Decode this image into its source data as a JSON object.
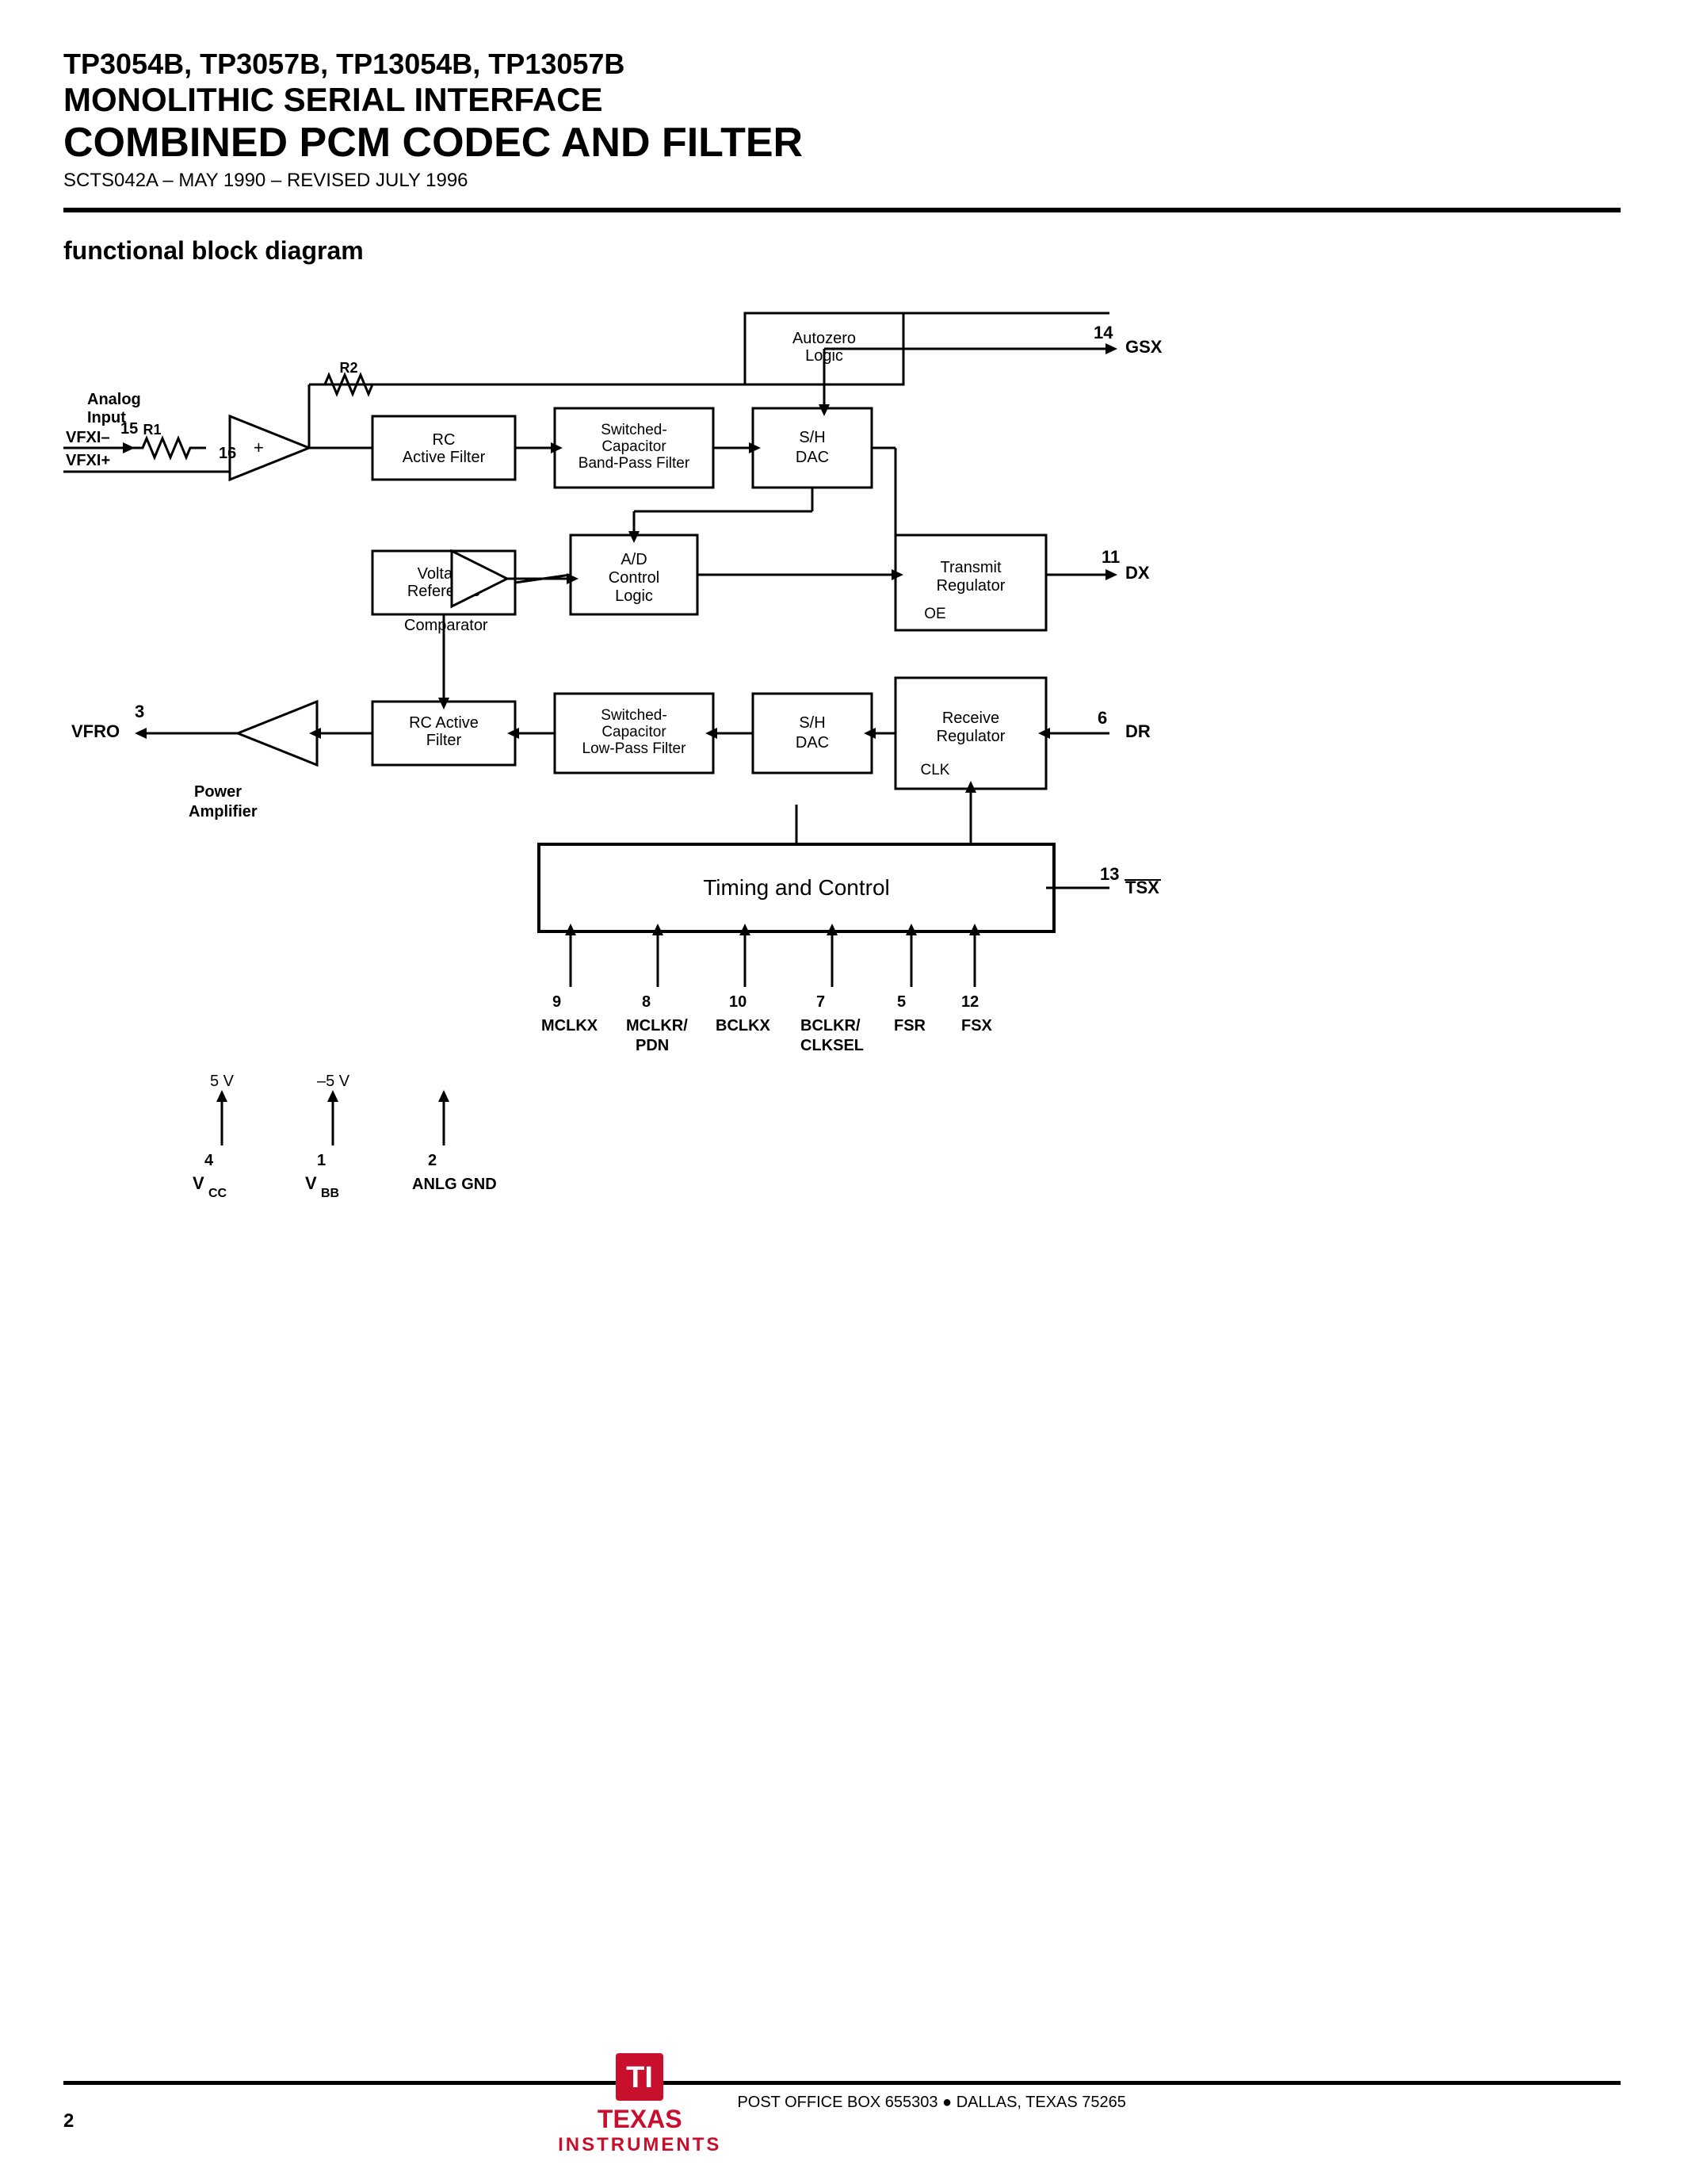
{
  "header": {
    "line1": "TP3054B, TP3057B, TP13054B, TP13057B",
    "line2": "MONOLITHIC SERIAL INTERFACE",
    "line3": "COMBINED PCM CODEC AND FILTER",
    "subtitle": "SCTS042A – MAY 1990 – REVISED JULY 1996"
  },
  "section": {
    "title": "functional block diagram"
  },
  "blocks": {
    "autozero_logic": "Autozero\nLogic",
    "rc_active_filter_top": "RC\nActive Filter",
    "switched_cap_bpf": "Switched-\nCapacitor\nBand-Pass Filter",
    "sh_dac_top": "S/H\nDAC",
    "voltage_reference": "Voltage\nReference",
    "ad_control_logic": "A/D\nControl\nLogic",
    "transmit_regulator": "Transmit\nRegulator",
    "rc_active_filter_bot": "RC Active\nFilter",
    "switched_cap_lpf": "Switched-\nCapacitor\nLow-Pass Filter",
    "sh_dac_bot": "S/H\nDAC",
    "receive_regulator": "Receive\nRegulator",
    "timing_and_control": "Timing and Control"
  },
  "pins": {
    "gsx": {
      "num": "14",
      "label": "GSX"
    },
    "dx": {
      "num": "11",
      "label": "DX"
    },
    "dr": {
      "num": "6",
      "label": "DR"
    },
    "tsx": {
      "num": "13",
      "label": "͟TSX"
    },
    "vfxi_minus": {
      "num": "15",
      "label": "VFXI−"
    },
    "vfxi_plus": {
      "num": "16",
      "label": "VFXI+"
    },
    "vfro": {
      "num": "3",
      "label": "VFRO"
    },
    "vcc": {
      "num": "4",
      "label": "Vᴄᴄ"
    },
    "vbb": {
      "num": "1",
      "label": "Vʙʙ"
    },
    "anlg_gnd": {
      "num": "2",
      "label": "ANLG GND"
    },
    "mclkx": {
      "num": "9",
      "label": "MCLKX"
    },
    "mclkr_pdn": {
      "num": "8",
      "label": "MCLKR/\nPDN"
    },
    "bclkx": {
      "num": "10",
      "label": "BCLKX"
    },
    "bclkr_clksel": {
      "num": "7",
      "label": "BCLKR/\nCLKSEL"
    },
    "fsr": {
      "num": "5",
      "label": "FSR"
    },
    "fsx": {
      "num": "12",
      "label": "FSX"
    }
  },
  "labels": {
    "analog_input": "Analog\nInput",
    "r1": "R1",
    "r2": "R2",
    "comparator": "Comparator",
    "oe": "OE",
    "clk": "CLK",
    "power_amplifier": "Power\nAmplifier",
    "vcc_val": "5 V",
    "vbb_val": "−5 V"
  },
  "footer": {
    "page": "2",
    "address": "POST OFFICE BOX 655303 ● DALLAS, TEXAS 75265",
    "ti_name": "TEXAS",
    "ti_sub": "INSTRUMENTS"
  }
}
